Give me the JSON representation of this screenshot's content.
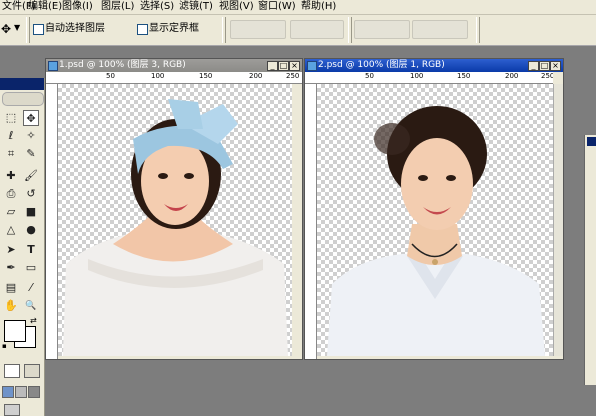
{
  "menu": [
    "文件(F)",
    "编辑(E)",
    "图像(I)",
    "图层(L)",
    "选择(S)",
    "滤镜(T)",
    "视图(V)",
    "窗口(W)",
    "帮助(H)"
  ],
  "options": {
    "auto_select_label": "自动选择图层",
    "show_bounds_label": "显示定界框"
  },
  "documents": [
    {
      "title": "1.psd @ 100% (图层 3, RGB)",
      "active": false,
      "ruler_labels": [
        "50",
        "100",
        "150",
        "200",
        "250"
      ]
    },
    {
      "title": "2.psd @ 100% (图层 1, RGB)",
      "active": true,
      "ruler_labels": [
        "50",
        "100",
        "150",
        "200",
        "250"
      ]
    }
  ],
  "window_buttons": {
    "minimize": "_",
    "maximize": "□",
    "close": "×"
  },
  "tools": {
    "move": "✥",
    "lasso": "ℓ",
    "crop": "⌗",
    "heal": "✚",
    "stamp": "⎙",
    "eraser": "▱",
    "blur": "●",
    "path": "➤",
    "pen": "✒",
    "type": "T",
    "notes": "▤",
    "hand": "✋",
    "zoom": "🔍"
  },
  "colors": {
    "title_active": "#0a3aa8",
    "title_inactive": "#8c8b88",
    "app_bg": "#7d7d7d",
    "chrome": "#ece9d8"
  }
}
